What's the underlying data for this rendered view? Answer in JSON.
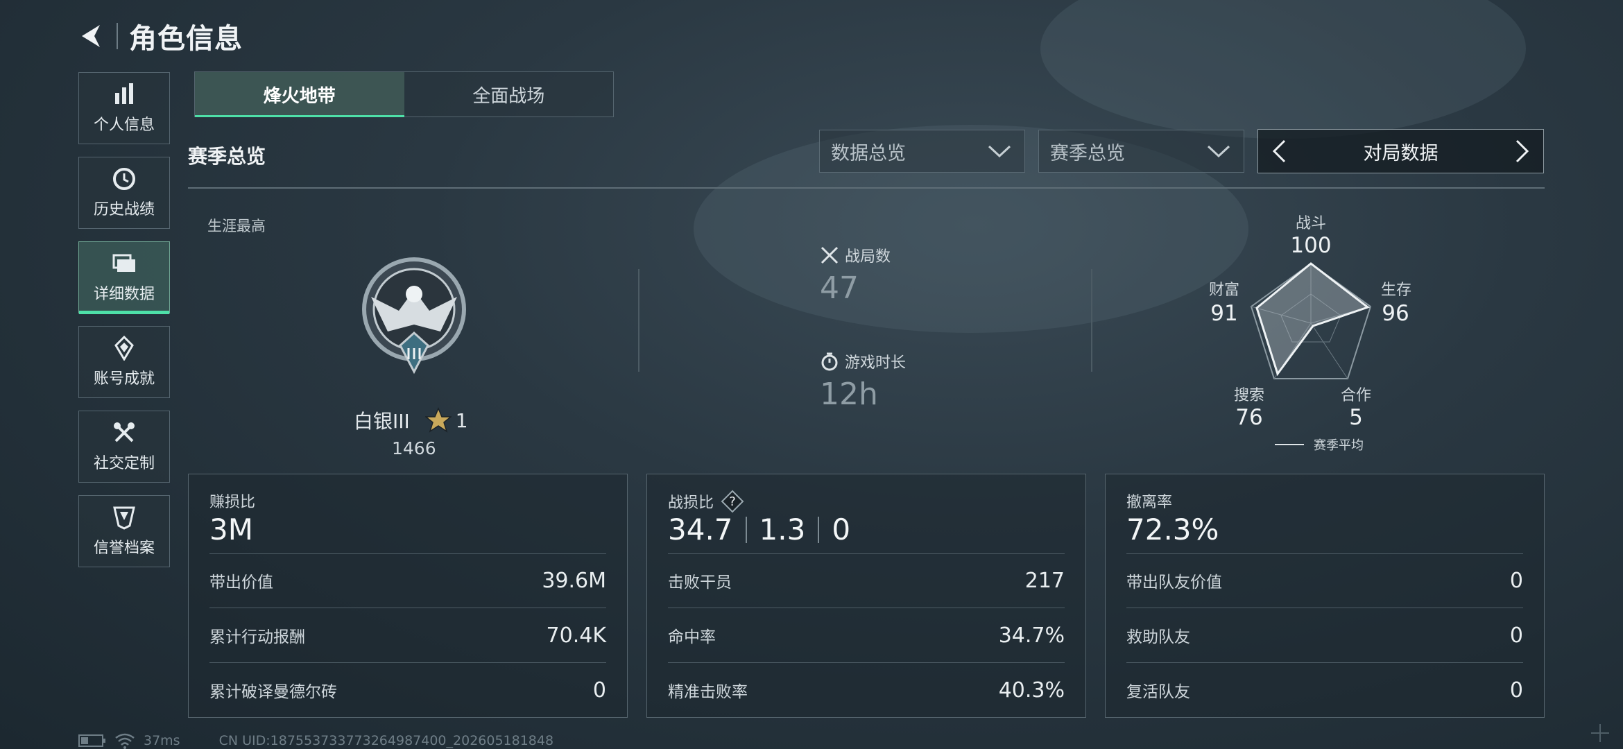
{
  "header": {
    "title": "角色信息"
  },
  "sidebar": {
    "items": [
      {
        "label": "个人信息",
        "icon": "bar-chart-icon"
      },
      {
        "label": "历史战绩",
        "icon": "clock-icon"
      },
      {
        "label": "详细数据",
        "icon": "folder-icon",
        "active": true
      },
      {
        "label": "账号成就",
        "icon": "medal-icon"
      },
      {
        "label": "社交定制",
        "icon": "tools-icon"
      },
      {
        "label": "信誉档案",
        "icon": "shield-badge-icon"
      }
    ]
  },
  "tabs": [
    {
      "label": "烽火地带",
      "active": true
    },
    {
      "label": "全面战场",
      "active": false
    }
  ],
  "section": {
    "title": "赛季总览"
  },
  "filters": {
    "data_overview": "数据总览",
    "season_overview": "赛季总览",
    "pager_label": "对局数据"
  },
  "career": {
    "label": "生涯最高",
    "rank_name": "白银III",
    "stars": "1",
    "score": "1466"
  },
  "match_stats": {
    "games_label": "战局数",
    "games_value": "47",
    "time_label": "游戏时长",
    "time_value": "12h"
  },
  "radar": {
    "axes": [
      {
        "label": "战斗",
        "value": "100"
      },
      {
        "label": "生存",
        "value": "96"
      },
      {
        "label": "合作",
        "value": "5"
      },
      {
        "label": "搜索",
        "value": "76"
      },
      {
        "label": "财富",
        "value": "91"
      }
    ],
    "legend": "赛季平均"
  },
  "cards": {
    "profit": {
      "title": "赚损比",
      "big": "3M",
      "rows": [
        {
          "label": "带出价值",
          "value": "39.6M"
        },
        {
          "label": "累计行动报酬",
          "value": "70.4K"
        },
        {
          "label": "累计破译曼德尔砖",
          "value": "0"
        }
      ]
    },
    "combat": {
      "title": "战损比",
      "ratio": [
        "34.7",
        "1.3",
        "0"
      ],
      "rows": [
        {
          "label": "击败干员",
          "value": "217"
        },
        {
          "label": "命中率",
          "value": "34.7%"
        },
        {
          "label": "精准击败率",
          "value": "40.3%"
        }
      ]
    },
    "extract": {
      "title": "撤离率",
      "big": "72.3%",
      "rows": [
        {
          "label": "带出队友价值",
          "value": "0"
        },
        {
          "label": "救助队友",
          "value": "0"
        },
        {
          "label": "复活队友",
          "value": "0"
        }
      ]
    }
  },
  "footer": {
    "ping": "37ms",
    "uid": "CN UID:187553733773264987400_202605181848"
  },
  "colors": {
    "accent": "#4ee0a8",
    "background": "#22303a"
  }
}
